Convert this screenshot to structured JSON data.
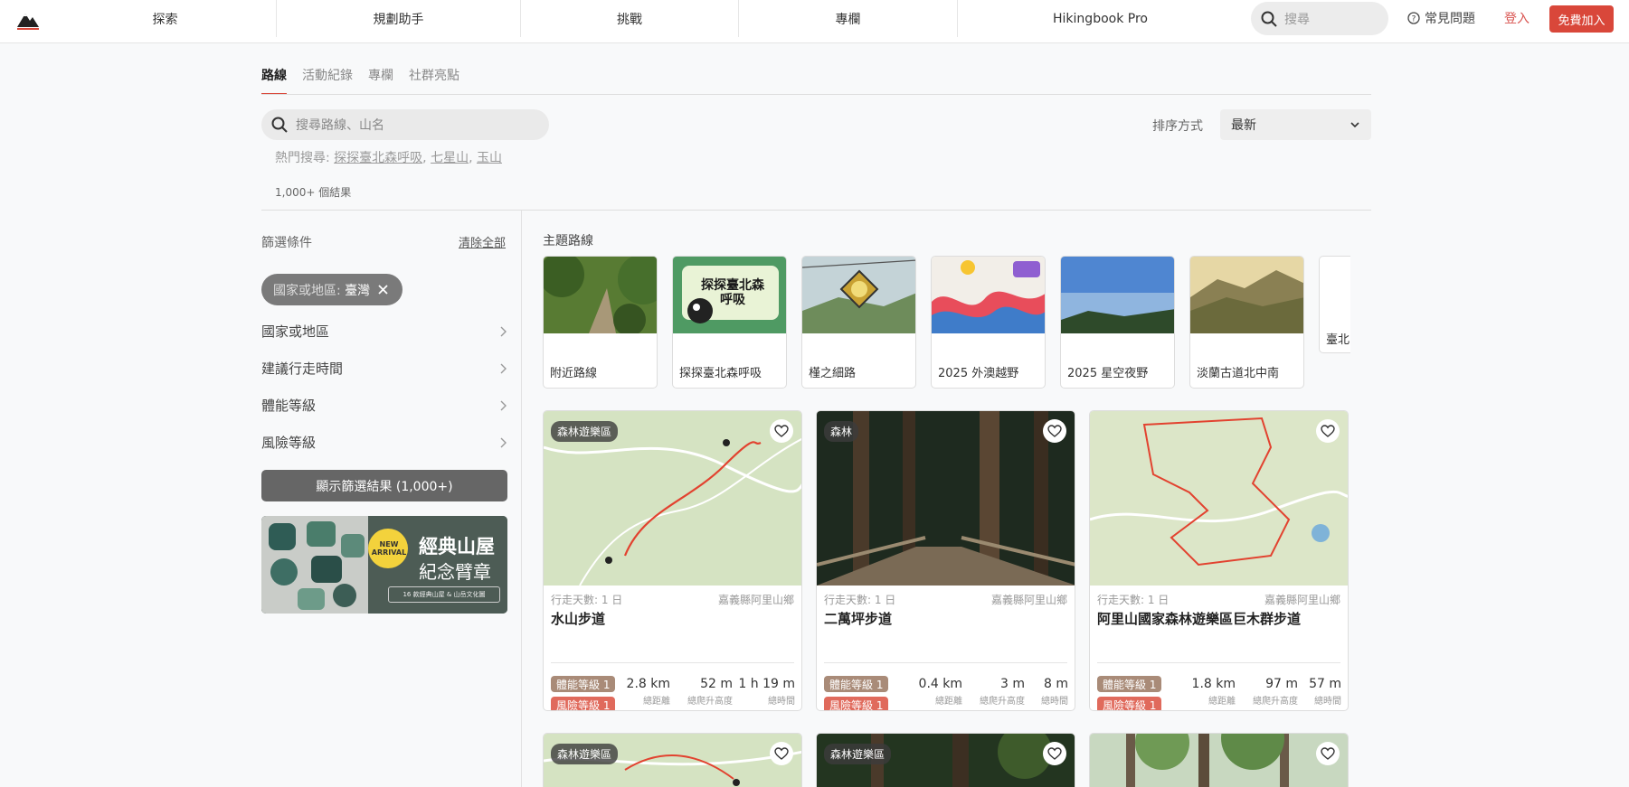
{
  "nav": {
    "items": [
      "探索",
      "規劃助手",
      "挑戰",
      "專欄",
      "Hikingbook Pro"
    ],
    "search_placeholder": "搜尋",
    "faq": "常見問題",
    "login": "登入",
    "join": "免費加入"
  },
  "tabs": [
    "路線",
    "活動紀錄",
    "專欄",
    "社群亮點"
  ],
  "search": {
    "placeholder": "搜尋路線、山名"
  },
  "hot": {
    "label": "熱門搜尋:",
    "items": [
      "探探臺北森呼吸",
      "七星山",
      "玉山"
    ]
  },
  "result_count": "1,000+ 個結果",
  "sort": {
    "label": "排序方式",
    "value": "最新"
  },
  "filters": {
    "title": "篩選條件",
    "clear": "清除全部",
    "chip_label": "國家或地區:",
    "chip_value": "臺灣",
    "rows": [
      "國家或地區",
      "建議行走時間",
      "體能等級",
      "風險等級"
    ],
    "show_button": "顯示篩選結果 (1,000+)"
  },
  "banner": {
    "badge": "NEW ARRIVAL",
    "title": "經典山屋",
    "subtitle": "紀念臂章",
    "caption": "16 款經典山屋 & 山岳文化圖"
  },
  "themes": {
    "title": "主題路線",
    "items": [
      "附近路線",
      "探探臺北森呼吸",
      "槿之細路",
      "2025 外澳越野",
      "2025 星空夜野",
      "淡蘭古道北中南",
      "臺北"
    ],
    "poster_text": "探探臺北森呼吸"
  },
  "cards": [
    {
      "badge": "森林遊樂區",
      "days": "行走天數: 1 日",
      "location": "嘉義縣阿里山鄉",
      "name": "水山步道",
      "fitness": "體能等級 1",
      "risk": "風險等級 1",
      "distance": "2.8 km",
      "elevation": "52 m",
      "time": "1 h 19 m"
    },
    {
      "badge": "森林",
      "days": "行走天數: 1 日",
      "location": "嘉義縣阿里山鄉",
      "name": "二萬坪步道",
      "fitness": "體能等級 1",
      "risk": "風險等級 1",
      "distance": "0.4 km",
      "elevation": "3 m",
      "time": "8 m"
    },
    {
      "badge": "",
      "days": "行走天數: 1 日",
      "location": "嘉義縣阿里山鄉",
      "name": "阿里山國家森林遊樂區巨木群步道",
      "fitness": "體能等級 1",
      "risk": "風險等級 1",
      "distance": "1.8 km",
      "elevation": "97 m",
      "time": "57 m"
    },
    {
      "badge": "森林遊樂區"
    },
    {
      "badge": "森林遊樂區"
    },
    {
      "badge": ""
    }
  ],
  "stat_units": {
    "distance": "總距離",
    "elevation": "總爬升高度",
    "time": "總時間"
  },
  "colors": {
    "accent": "#d9473a",
    "fitness": "#a98b78",
    "risk": "#e06a5c"
  }
}
